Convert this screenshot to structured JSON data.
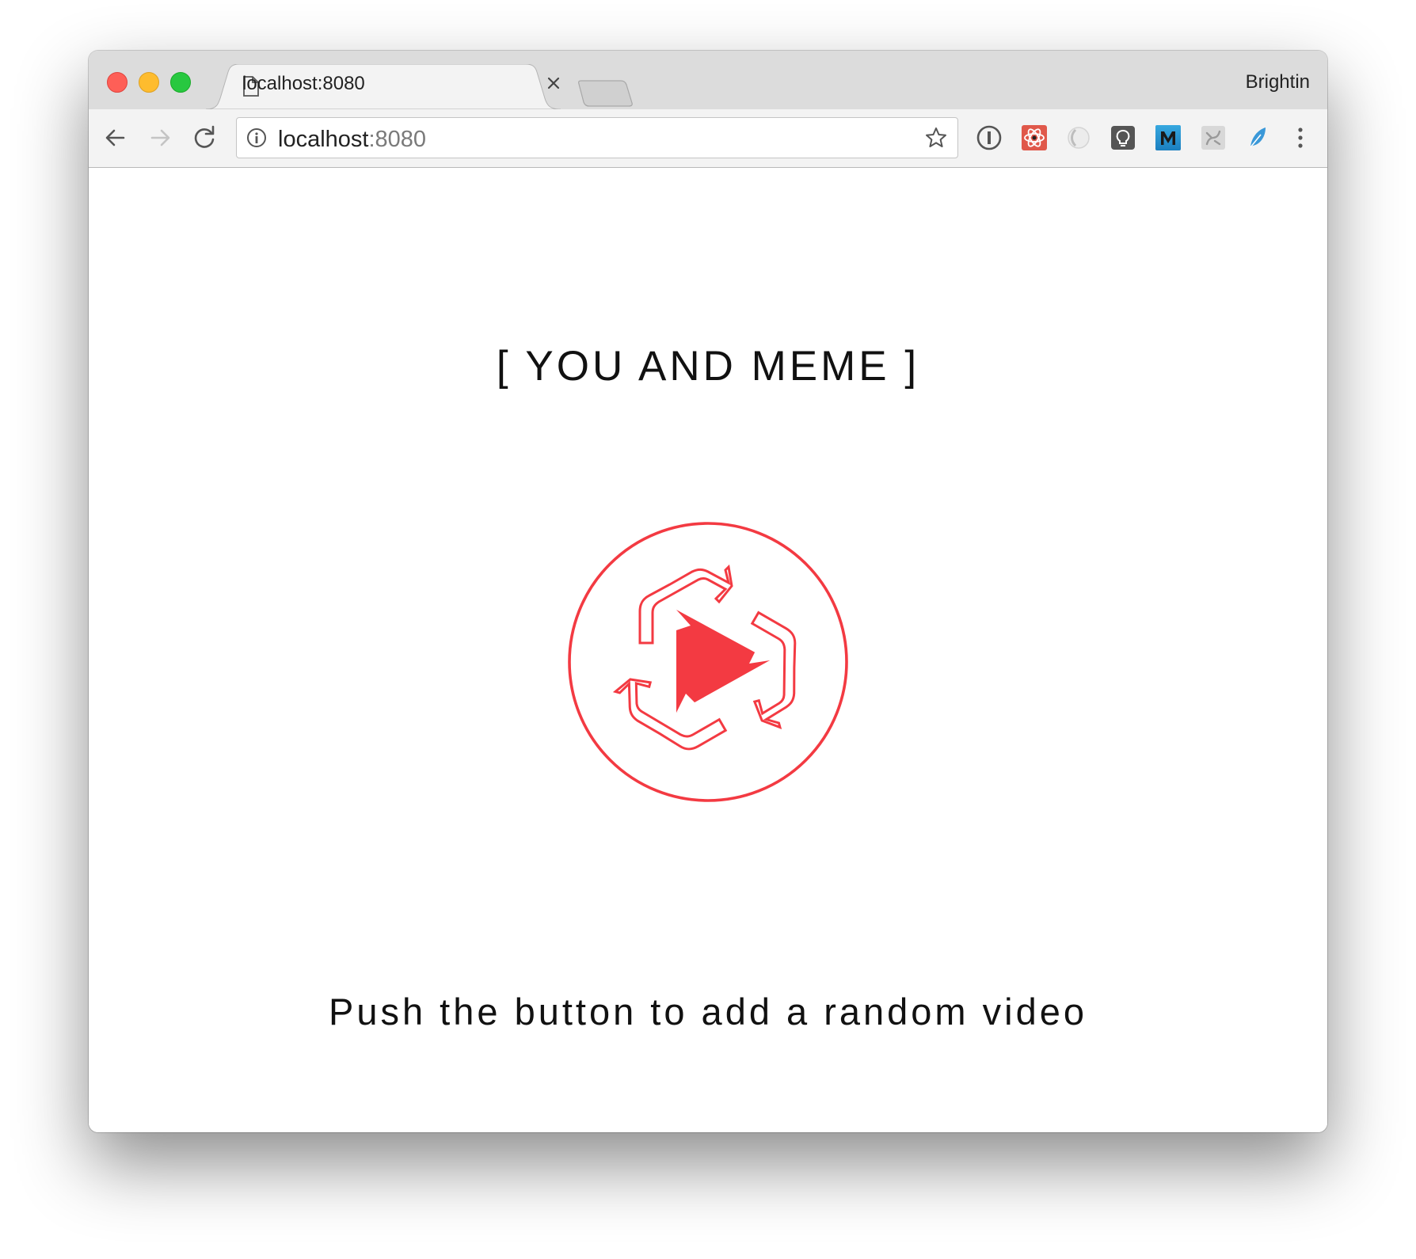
{
  "browser": {
    "tab": {
      "title": "localhost:8080"
    },
    "profile_name": "Brightin",
    "address_bar": {
      "host": "localhost",
      "port": ":8080"
    }
  },
  "page": {
    "title": "[ YOU AND MEME ]",
    "hint": "Push the button to add a random video"
  },
  "colors": {
    "accent": "#f33a42",
    "page_bg": "#ffffff",
    "text": "#111111"
  },
  "icons": {
    "extensions": [
      "password-manager-icon",
      "react-devtools-icon",
      "ghost-extension-icon",
      "lightbulb-extension-icon",
      "m-extension-icon",
      "puzzle-extension-icon",
      "feather-extension-icon"
    ]
  }
}
